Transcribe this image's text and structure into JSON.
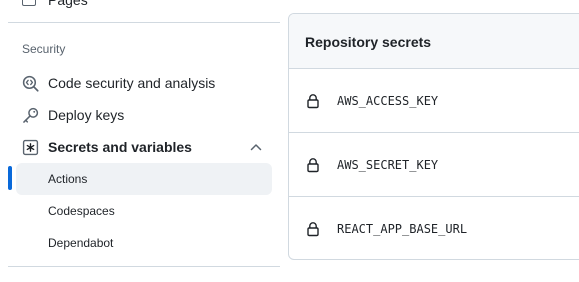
{
  "sidebar": {
    "top_item_label": "Pages",
    "section_label": "Security",
    "items": [
      {
        "label": "Code security and analysis",
        "icon": "codescan-icon"
      },
      {
        "label": "Deploy keys",
        "icon": "key-icon"
      },
      {
        "label": "Secrets and variables",
        "icon": "asterisk-icon",
        "expanded": true
      }
    ],
    "sub_items": [
      {
        "label": "Actions",
        "active": true
      },
      {
        "label": "Codespaces",
        "active": false
      },
      {
        "label": "Dependabot",
        "active": false
      }
    ]
  },
  "panel": {
    "title": "Repository secrets",
    "secrets": [
      {
        "name": "AWS_ACCESS_KEY",
        "icon": "lock-icon"
      },
      {
        "name": "AWS_SECRET_KEY",
        "icon": "lock-icon"
      },
      {
        "name": "REACT_APP_BASE_URL",
        "icon": "lock-icon"
      }
    ]
  },
  "colors": {
    "accent": "#0969da",
    "border": "#d1d9e0",
    "muted_text": "#59636e",
    "active_bg": "#eff2f5"
  }
}
